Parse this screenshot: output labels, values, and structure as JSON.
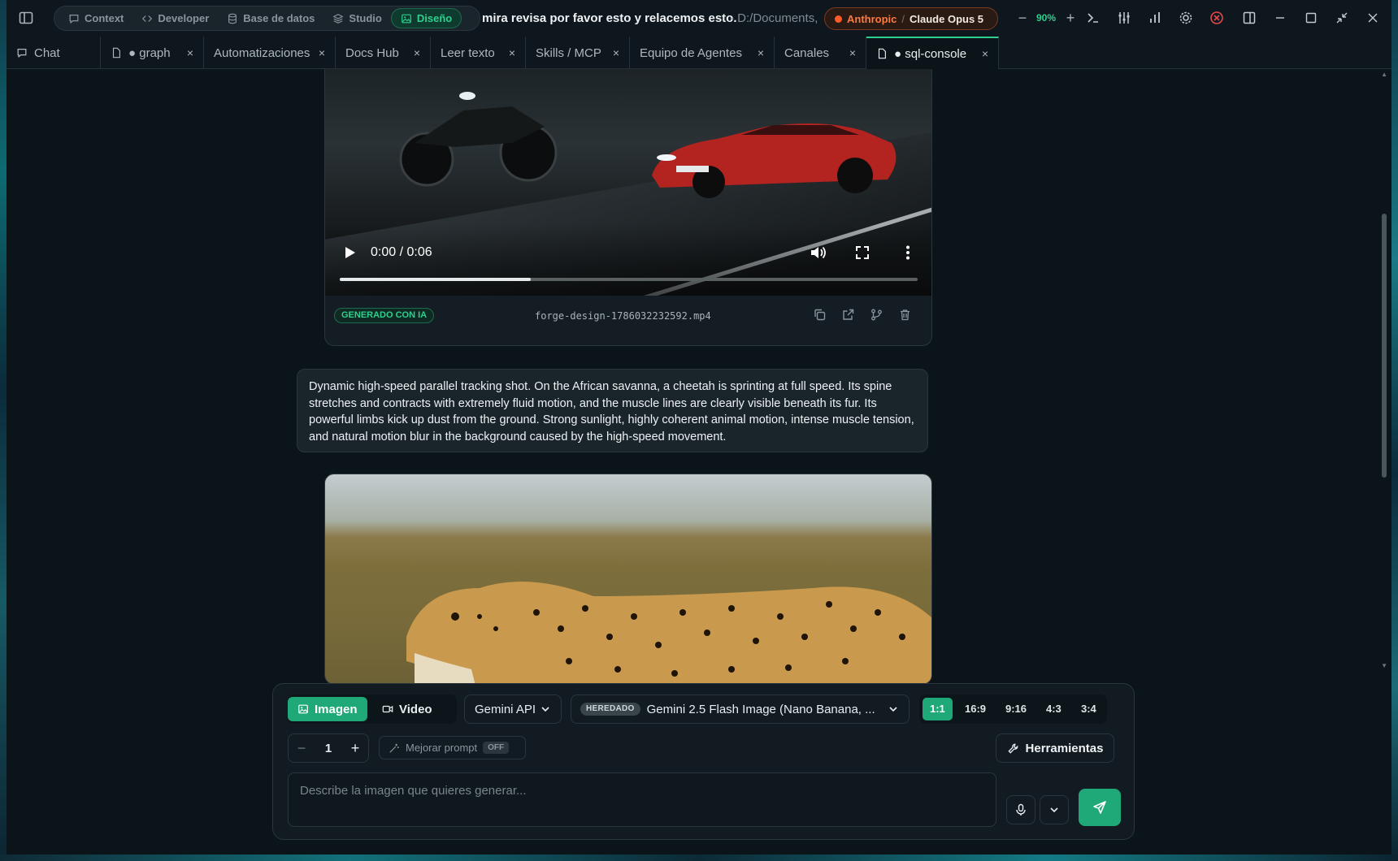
{
  "titlebar": {
    "modes": [
      {
        "label": "Context",
        "icon": "chat-bubble-icon"
      },
      {
        "label": "Developer",
        "icon": "code-icon"
      },
      {
        "label": "Base de datos",
        "icon": "database-icon"
      },
      {
        "label": "Studio",
        "icon": "layers-icon"
      },
      {
        "label": "Diseño",
        "icon": "image-icon",
        "active": true
      }
    ],
    "title": "mira revisa por favor esto y relacemos esto.",
    "path": "- D:/Documents,",
    "provider": "Anthropic",
    "separator": "/",
    "model": "Claude Opus 5",
    "zoom": "90%",
    "zoom_minus": "−",
    "zoom_plus": "+"
  },
  "tabs": [
    {
      "label": "Chat",
      "icon": "chat-bubble-icon"
    },
    {
      "label": "● graph",
      "icon": "file-icon",
      "close": "×"
    },
    {
      "label": "Automatizaciones",
      "close": "×"
    },
    {
      "label": "Docs Hub",
      "close": "×"
    },
    {
      "label": "Leer texto",
      "close": "×"
    },
    {
      "label": "Skills / MCP",
      "close": "×"
    },
    {
      "label": "Equipo de Agentes",
      "close": "×"
    },
    {
      "label": "Canales",
      "close": "×"
    },
    {
      "label": "● sql-console",
      "icon": "file-icon",
      "close": "×",
      "active": true
    }
  ],
  "video": {
    "time": "0:00 / 0:06",
    "progress_fraction": 0.33,
    "badge": "GENERADO CON IA",
    "filename": "forge-design-1786032232592.mp4"
  },
  "prompt_text": "Dynamic high-speed parallel tracking shot. On the African savanna, a cheetah is sprinting at full speed. Its spine stretches and contracts with extremely fluid motion, and the muscle lines are clearly visible beneath its fur. Its powerful limbs kick up dust from the ground. Strong sunlight, highly coherent animal motion, intense muscle tension, and natural motion blur in the background caused by the high-speed movement.",
  "composer": {
    "mode_image": "Imagen",
    "mode_video": "Video",
    "api": "Gemini API",
    "model_badge": "HEREDADO",
    "model": "Gemini 2.5 Flash Image (Nano Banana, ...",
    "ratios": [
      "1:1",
      "16:9",
      "9:16",
      "4:3",
      "3:4"
    ],
    "active_ratio": "1:1",
    "count": "1",
    "count_minus": "−",
    "count_plus": "+",
    "improve_label": "Mejorar prompt",
    "improve_state": "OFF",
    "tools_label": "Herramientas",
    "input_placeholder": "Describe la imagen que quieres generar..."
  },
  "colors": {
    "accent": "#1fa878",
    "accent_text": "#2fcf8f",
    "provider": "#ff7a3e",
    "background": "#0b1419"
  }
}
